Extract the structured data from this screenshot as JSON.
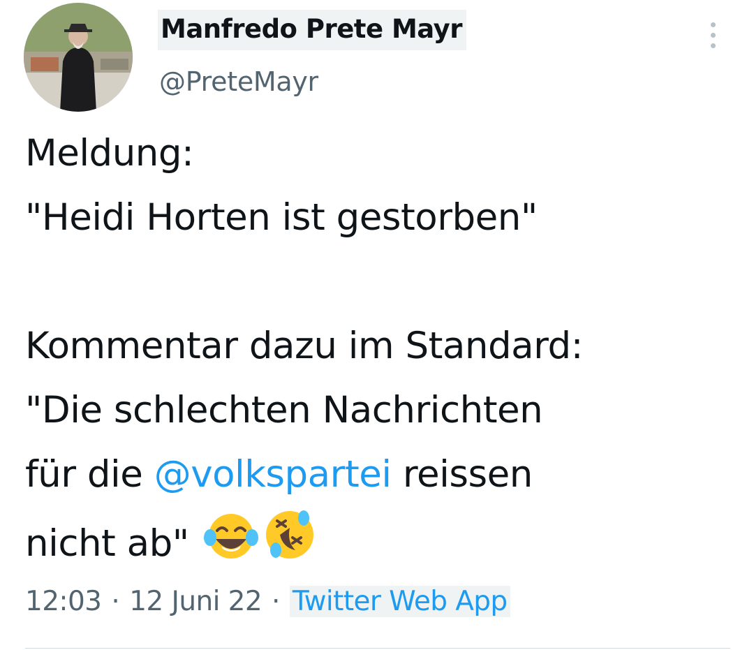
{
  "author": {
    "display_name": "Manfredo Prete Mayr",
    "handle": "@PreteMayr"
  },
  "tweet": {
    "line1": "Meldung:",
    "line2": "\"Heidi Horten ist gestorben\"",
    "line3": "",
    "line4": "Kommentar dazu im Standard:",
    "line5": "\"Die schlechten Nachrichten",
    "line6_before": "für die ",
    "mention": "@volkspartei",
    "line6_after": " reissen",
    "line7": "nicht ab\"",
    "emojis": [
      "face-with-tears-of-joy",
      "rolling-on-the-floor-laughing"
    ]
  },
  "meta": {
    "time": "12:03",
    "separator": "·",
    "date": "12 Juni 22",
    "source": "Twitter Web App"
  },
  "colors": {
    "link": "#1d9bf0",
    "secondary_text": "#536471",
    "highlight": "#eff3f4"
  }
}
